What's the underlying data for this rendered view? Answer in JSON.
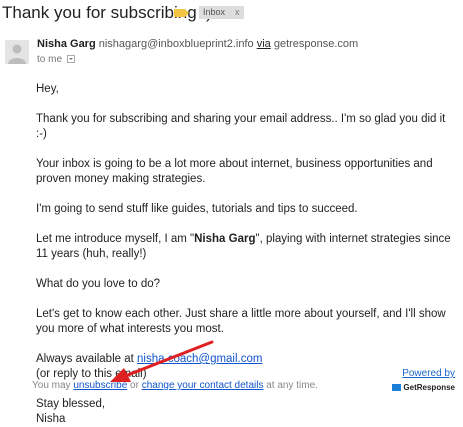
{
  "header": {
    "subject": "Thank you for subscribing :)",
    "label_chip": "Inbox",
    "label_chip_close": "x"
  },
  "sender": {
    "name": "Nisha Garg",
    "email": "nishagarg@inboxblueprint2.info",
    "via_word": "via",
    "via_domain": "getresponse.com",
    "recipient": "to me"
  },
  "message": {
    "greeting": "Hey,",
    "p1": "Thank you for subscribing and sharing your email address.. I'm so glad you did it :-)",
    "p2": "Your inbox is going to be a lot more about internet, business opportunities and proven money making strategies.",
    "p3": "I'm going to send stuff like guides, tutorials and tips to succeed.",
    "p4_before": "Let me introduce myself, I am \"",
    "p4_name": "Nisha Garg",
    "p4_after": "\", playing with internet strategies since 11 years (huh, really!)",
    "p5": "What do you love to do?",
    "p6": "Let's get to know each other. Just share a little more about yourself, and I'll show you more of what interests you most.",
    "availability_prefix": "Always available at",
    "contact_email": "nisha.coach@gmail.com",
    "reply_note": "(or reply to this email)",
    "signoff": "Stay blessed,",
    "signature": "Nisha"
  },
  "footer": {
    "prefix": "You may",
    "unsubscribe": "unsubscribe",
    "or_word": "or",
    "change_details": "change your contact details",
    "suffix": "at any time.",
    "powered_by": "Powered by",
    "brand": "GetResponse"
  },
  "colors": {
    "link": "#1155cc",
    "annotation_arrow": "#e02020",
    "label_tag": "#f4c542"
  }
}
